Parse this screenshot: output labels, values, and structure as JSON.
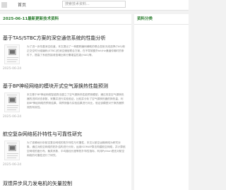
{
  "topbar": {
    "home_label": "首页",
    "search_placeholder": "搜索技术资料..."
  },
  "main": {
    "heading": "2025-06-11最新更新技术资料"
  },
  "sidebar": {
    "heading": "资料分类"
  },
  "articles": [
    {
      "title": "基于TAS/STBC方案的深空通信系统的性能分析",
      "snippet": "为了进一步改善深空信道，本文提出了一种跟踪编码辅助的联合发射天线选择(TAS)和正交空时分组编码(STBC)的深空通信联合方案，在不导致额外bit/Hz通道传输时的条件下，提高了系统的接收信噪比和分集增益性能(HAS)等。",
      "date": "2025-06-24"
    },
    {
      "title": "基于BP神经网络的模块开式空气源换热性能预测",
      "snippet": "本文基于BP神经网络智能算法建立了空气源换热性能预测模型，通过改变空气源换热器的进风状态参数，采集并进行实验验证，比较并分析了空气源换热器的换热量，利用BP神经网络的预测结果，将预测值与实验结果进行对比，验证该模型对于换热器预测的有效性。",
      "date": "2025-06-24"
    },
    {
      "title": "航空复杂网络拓扑特性与可靠性研究",
      "snippet": "为了准确地分析航空复杂网络的拓扑特性与可靠性，本文以航空运输网络为研究对象，通过对航空网络的拓扑结构进行分析，运用ISOMAP算法构建航空网络，并计算航空网络的度分布、聚类系数、平均路径长度等拓扑特性指标，利用Python语言对航空网络的可靠性进行了研究。",
      "date": "2025-06-24"
    },
    {
      "title": "双馈异步风力发电机的矢量控制",
      "snippet": "",
      "date": ""
    }
  ]
}
